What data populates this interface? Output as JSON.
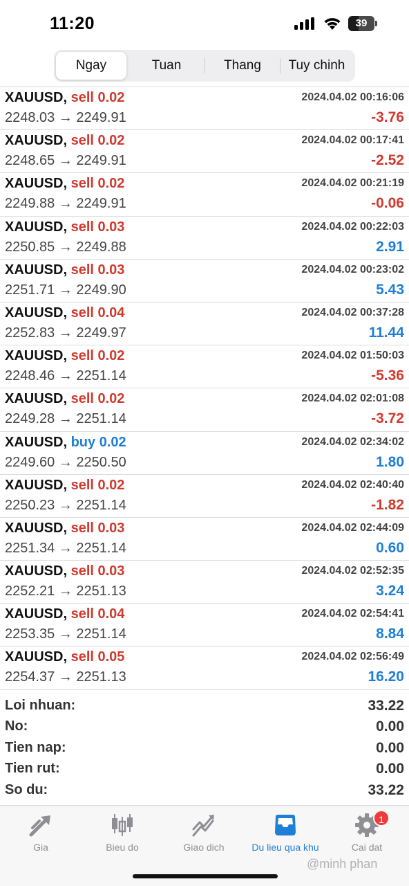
{
  "status_bar": {
    "time": "11:20",
    "battery": "39",
    "battery_level": 0.39
  },
  "tabs_top": [
    {
      "label": "Ngay",
      "active": true
    },
    {
      "label": "Tuan",
      "active": false
    },
    {
      "label": "Thang",
      "active": false
    },
    {
      "label": "Tuy chinh",
      "active": false
    }
  ],
  "deals": [
    {
      "symbol": "XAUUSD,",
      "side": "sell 0.02",
      "time": "2024.04.02 00:16:06",
      "prices": "2248.03 → 2249.91",
      "profit": "-3.76"
    },
    {
      "symbol": "XAUUSD,",
      "side": "sell 0.02",
      "time": "2024.04.02 00:17:41",
      "prices": "2248.65 → 2249.91",
      "profit": "-2.52"
    },
    {
      "symbol": "XAUUSD,",
      "side": "sell 0.02",
      "time": "2024.04.02 00:21:19",
      "prices": "2249.88 → 2249.91",
      "profit": "-0.06"
    },
    {
      "symbol": "XAUUSD,",
      "side": "sell 0.03",
      "time": "2024.04.02 00:22:03",
      "prices": "2250.85 → 2249.88",
      "profit": "2.91"
    },
    {
      "symbol": "XAUUSD,",
      "side": "sell 0.03",
      "time": "2024.04.02 00:23:02",
      "prices": "2251.71 → 2249.90",
      "profit": "5.43"
    },
    {
      "symbol": "XAUUSD,",
      "side": "sell 0.04",
      "time": "2024.04.02 00:37:28",
      "prices": "2252.83 → 2249.97",
      "profit": "11.44"
    },
    {
      "symbol": "XAUUSD,",
      "side": "sell 0.02",
      "time": "2024.04.02 01:50:03",
      "prices": "2248.46 → 2251.14",
      "profit": "-5.36"
    },
    {
      "symbol": "XAUUSD,",
      "side": "sell 0.02",
      "time": "2024.04.02 02:01:08",
      "prices": "2249.28 → 2251.14",
      "profit": "-3.72"
    },
    {
      "symbol": "XAUUSD,",
      "side": "buy 0.02",
      "time": "2024.04.02 02:34:02",
      "prices": "2249.60 → 2250.50",
      "profit": "1.80"
    },
    {
      "symbol": "XAUUSD,",
      "side": "sell 0.02",
      "time": "2024.04.02 02:40:40",
      "prices": "2250.23 → 2251.14",
      "profit": "-1.82"
    },
    {
      "symbol": "XAUUSD,",
      "side": "sell 0.03",
      "time": "2024.04.02 02:44:09",
      "prices": "2251.34 → 2251.14",
      "profit": "0.60"
    },
    {
      "symbol": "XAUUSD,",
      "side": "sell 0.03",
      "time": "2024.04.02 02:52:35",
      "prices": "2252.21 → 2251.13",
      "profit": "3.24"
    },
    {
      "symbol": "XAUUSD,",
      "side": "sell 0.04",
      "time": "2024.04.02 02:54:41",
      "prices": "2253.35 → 2251.14",
      "profit": "8.84"
    },
    {
      "symbol": "XAUUSD,",
      "side": "sell 0.05",
      "time": "2024.04.02 02:56:49",
      "prices": "2254.37 → 2251.13",
      "profit": "16.20"
    }
  ],
  "summary": [
    {
      "label": "Loi nhuan:",
      "value": "33.22"
    },
    {
      "label": "No:",
      "value": "0.00"
    },
    {
      "label": "Tien nap:",
      "value": "0.00"
    },
    {
      "label": "Tien rut:",
      "value": "0.00"
    },
    {
      "label": "So du:",
      "value": "33.22"
    }
  ],
  "tabbar": [
    {
      "label": "Gia",
      "icon": "quotes-arrows-icon",
      "active": false
    },
    {
      "label": "Bieu do",
      "icon": "candlestick-chart-icon",
      "active": false
    },
    {
      "label": "Giao dich",
      "icon": "trade-chart-icon",
      "active": false
    },
    {
      "label": "Du lieu qua khu",
      "icon": "history-tray-icon",
      "active": true
    },
    {
      "label": "Cai dat",
      "icon": "gear-icon",
      "active": false,
      "badge": "1"
    }
  ],
  "watermark": "@minh phan",
  "colors": {
    "sell": "#d03a2e",
    "buy": "#1f7fd6",
    "loss": "#d03a2e",
    "gain": "#1f7fd6",
    "active_tab": "#1f7fd6",
    "inactive_tab": "#8e8e93",
    "badge": "#ee3b3b"
  }
}
